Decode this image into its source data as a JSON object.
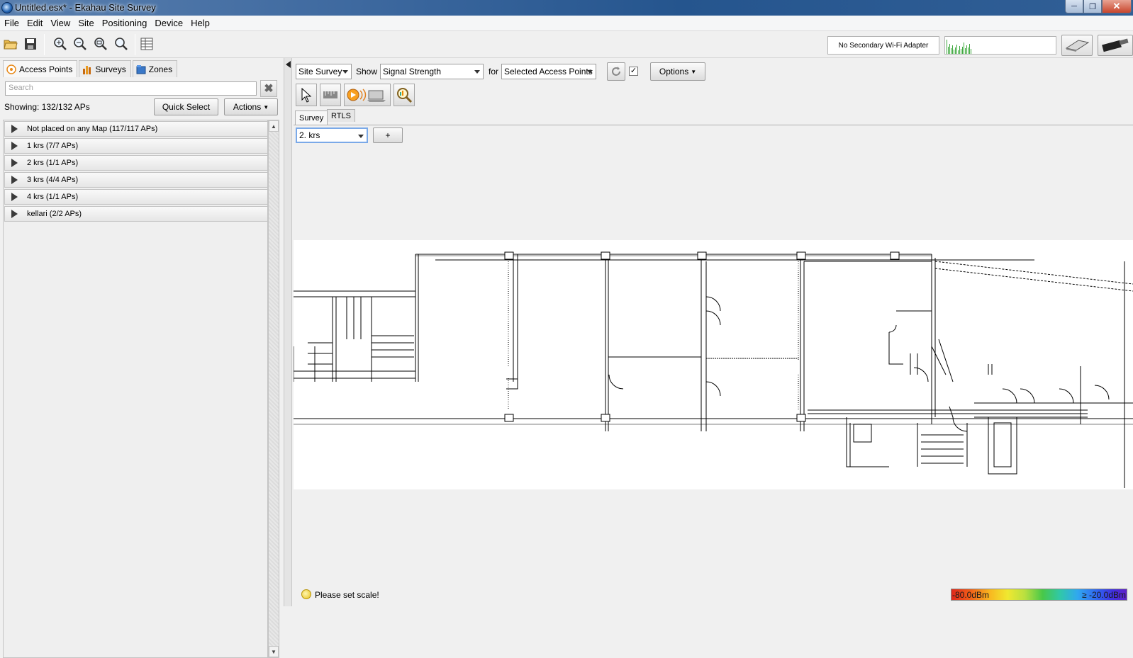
{
  "window": {
    "title": "Untitled.esx* - Ekahau Site Survey"
  },
  "menu": [
    "File",
    "Edit",
    "View",
    "Site",
    "Positioning",
    "Device",
    "Help"
  ],
  "toolbar": {
    "adapter_text": "No Secondary Wi-Fi Adapter"
  },
  "left": {
    "tabs": [
      "Access Points",
      "Surveys",
      "Zones"
    ],
    "search_placeholder": "Search",
    "showing": "Showing: 132/132 APs",
    "quick_select": "Quick Select",
    "actions": "Actions",
    "groups": [
      "Not placed on any Map (117/117 APs)",
      "1 krs (7/7 APs)",
      "2 krs (1/1 APs)",
      "3 krs (4/4 APs)",
      "4 krs (1/1 APs)",
      "kellari (2/2 APs)"
    ]
  },
  "right": {
    "mode": "Site Survey",
    "show_label": "Show",
    "show_value": "Signal Strength",
    "for_label": "for",
    "for_value": "Selected Access Points",
    "options": "Options",
    "subtabs": [
      "Survey",
      "RTLS"
    ],
    "floor": "2. krs",
    "add": "+",
    "status": "Please set scale!",
    "legend_min": "-80.0dBm",
    "legend_max": "≥ -20.0dBm"
  },
  "colors": {
    "accent": "#1f5fae",
    "warning": "#e7c21a"
  }
}
